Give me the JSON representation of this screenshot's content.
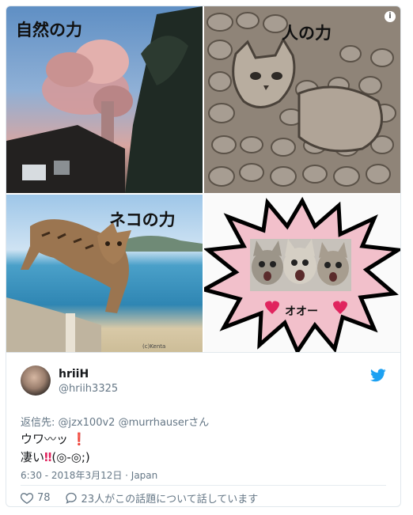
{
  "panels": {
    "nature_title": "自然の力",
    "human_title": "人の力",
    "cat_title": "ネコの力",
    "credit": "(c)Kenta",
    "exclaim": "オオー"
  },
  "info_icon": "i",
  "tweet": {
    "name": "hriiH",
    "handle": "@hriih3325",
    "reply_prefix": "返信先:",
    "reply_to": "@jzx100v2 @murrhauserさん",
    "line1": "ウワ〰ッ",
    "line2_text": "凄い",
    "line2_face": "(◎-◎;)",
    "meta": "6:30 - 2018年3月12日 · Japan",
    "likes": "78",
    "conversation": "23人がこの話題について話しています"
  },
  "colors": {
    "accent": "#1da1f2",
    "heart": "#e0245e",
    "muted": "#657786"
  }
}
